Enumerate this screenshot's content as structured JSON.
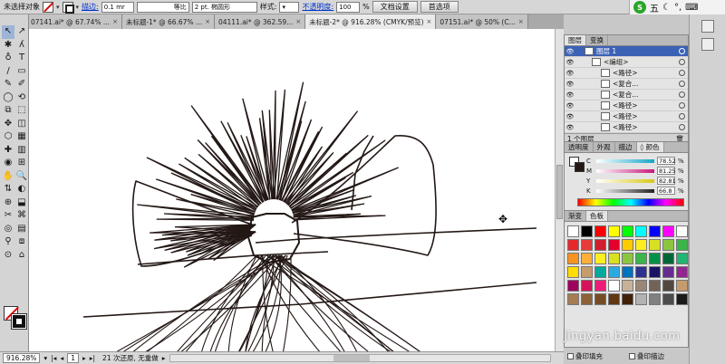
{
  "control_bar": {
    "selection_status": "未选择对象",
    "stroke_label": "描边:",
    "stroke_weight": "0.1 mr",
    "uniform": "等比",
    "brush": "2 pt. 椭圆形",
    "style_label": "样式:",
    "opacity_label": "不透明度:",
    "opacity_value": "100",
    "percent": "%",
    "doc_setup": "文档设置",
    "preferences": "首选项"
  },
  "ime": {
    "logo": "S",
    "mode": "五"
  },
  "tabs": [
    {
      "label": "07141.ai* @ 67.74% ..."
    },
    {
      "label": "未标题-1* @ 66.67% ..."
    },
    {
      "label": "04111.ai* @ 362.59..."
    },
    {
      "label": "未标题-2* @ 916.28% (CMYK/预览)",
      "active": true
    },
    {
      "label": "07151.ai* @ 50% (C..."
    }
  ],
  "tools": [
    "↖",
    "↗",
    "✱",
    "ʎ",
    "♁",
    "T",
    "/",
    "▭",
    "✎",
    "✐",
    "◯",
    "⟲",
    "⧉",
    "⬚",
    "✥",
    "◫",
    "⬡",
    "▦",
    "✚",
    "▥",
    "◉",
    "⊞",
    "✋",
    "🔍",
    "⇅",
    "◐",
    "⊕",
    "⬓",
    "✂",
    "⌘",
    "◎",
    "▤",
    "⚲",
    "⧈",
    "⊙",
    "⌂"
  ],
  "status_bar": {
    "zoom": "916.28%",
    "page": "1",
    "message": "21 次还原, 无重做"
  },
  "layers_panel": {
    "tabs": [
      "图层",
      "变换"
    ],
    "rows": [
      {
        "label": "图层 1",
        "top": true
      },
      {
        "label": "<编组>"
      },
      {
        "label": "<路径>"
      },
      {
        "label": "<复合..."
      },
      {
        "label": "<复合..."
      },
      {
        "label": "<路径>"
      },
      {
        "label": "<路径>"
      },
      {
        "label": "<路径>"
      }
    ],
    "footer": "1 个图层"
  },
  "color_panel": {
    "tabs": [
      "透明度",
      "外观",
      "描边",
      "◊ 颜色"
    ],
    "channels": [
      {
        "name": "C",
        "value": "78.52",
        "color": "#14a7c9"
      },
      {
        "name": "M",
        "value": "81.25",
        "color": "#c8177b"
      },
      {
        "name": "Y",
        "value": "82.81",
        "color": "#d8c814"
      },
      {
        "name": "K",
        "value": "66.8",
        "color": "#222222"
      }
    ],
    "percent": "%"
  },
  "swatches_panel": {
    "tabs": [
      "渐变",
      "色板"
    ],
    "colors": [
      "#ffffff",
      "#000000",
      "#ff0000",
      "#ffff00",
      "#00ff00",
      "#00ffff",
      "#0000ff",
      "#ff00ff",
      "#ffffff",
      "#e6282b",
      "#e83b3b",
      "#cf1f2f",
      "#e6002d",
      "#ffcc00",
      "#fcee21",
      "#d9e021",
      "#8cc63f",
      "#39b54a",
      "#f7931e",
      "#fbb03b",
      "#fcee21",
      "#d9e021",
      "#8cc63f",
      "#39b54a",
      "#009245",
      "#006837",
      "#22b573",
      "#ffdd00",
      "#c69c6d",
      "#00a99d",
      "#29abe2",
      "#0071bc",
      "#2e3192",
      "#1b1464",
      "#662d91",
      "#93278f",
      "#9e005d",
      "#d4145a",
      "#ed1e79",
      "#ffffff",
      "#c7b299",
      "#998675",
      "#736357",
      "#534741",
      "#c69c6d",
      "#a67c52",
      "#8c6239",
      "#754c24",
      "#603813",
      "#42210b",
      "#b3b3b3",
      "#808080",
      "#4d4d4d",
      "#1a1a1a"
    ],
    "overprint_fill": "叠印填充",
    "overprint_stroke": "叠印描边"
  },
  "watermark": "jingyan.baidu.com"
}
